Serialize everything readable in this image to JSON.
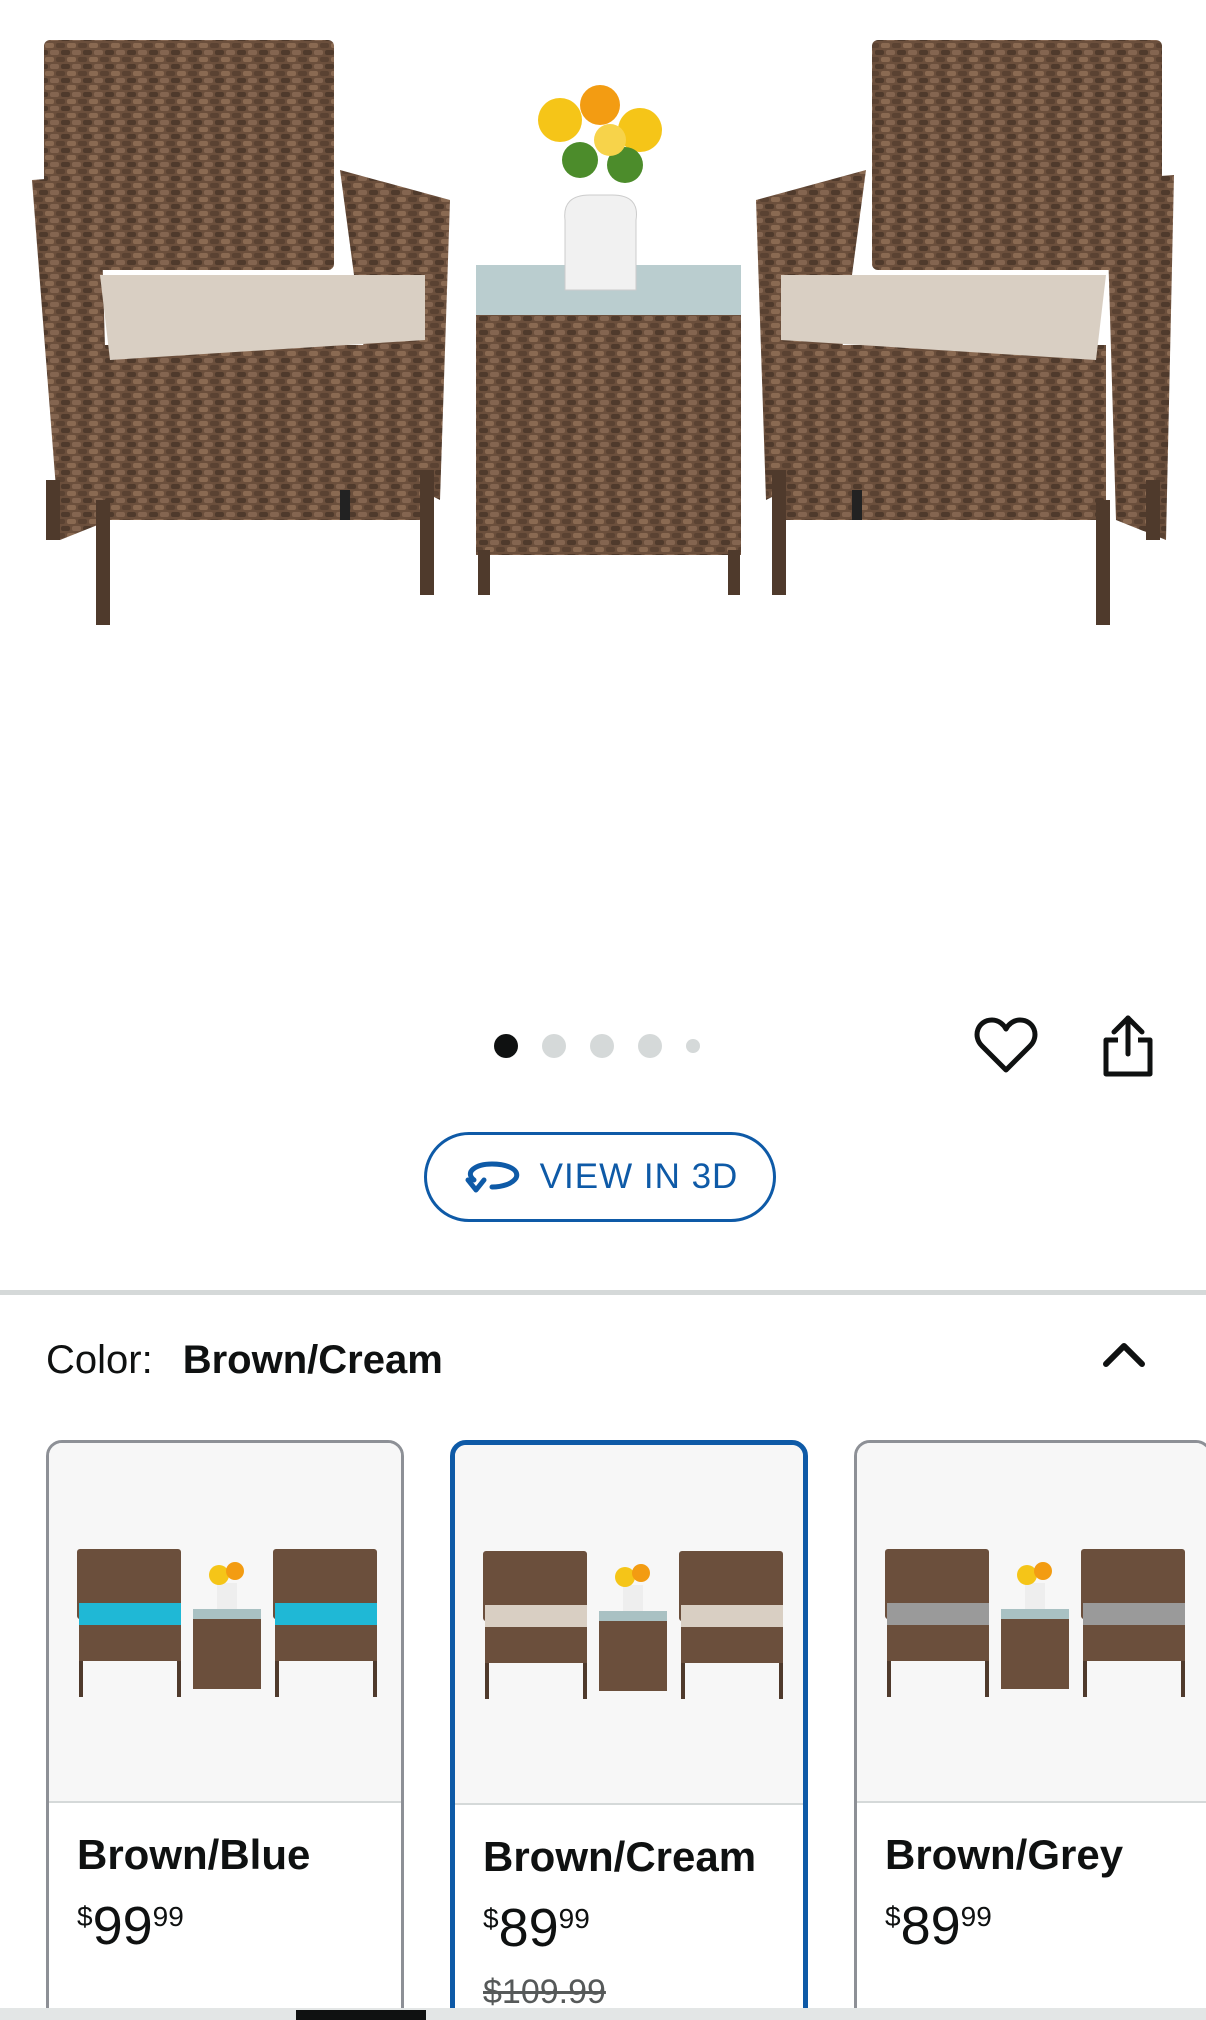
{
  "carousel": {
    "dot_count": 5,
    "active_index": 0
  },
  "actions": {
    "favorite_icon": "heart-icon",
    "share_icon": "share-icon"
  },
  "view3d": {
    "label": "VIEW IN 3D",
    "icon": "rotate-3d-icon"
  },
  "color_selector": {
    "label": "Color:",
    "value": "Brown/Cream",
    "toggle_icon": "chevron-up-icon"
  },
  "swatches": [
    {
      "name": "Brown/Blue",
      "price_symbol": "$",
      "price_whole": "99",
      "price_fraction": "99",
      "list_price": "",
      "cushion_color": "#1fb8d6",
      "selected": false
    },
    {
      "name": "Brown/Cream",
      "price_symbol": "$",
      "price_whole": "89",
      "price_fraction": "99",
      "list_price": "$109.99",
      "cushion_color": "#d9cfc3",
      "selected": true
    },
    {
      "name": "Brown/Grey",
      "price_symbol": "$",
      "price_whole": "89",
      "price_fraction": "99",
      "list_price": "",
      "cushion_color": "#9a9a9a",
      "selected": false
    }
  ],
  "colors": {
    "accent": "#0e5aa7",
    "wicker": "#6b4f3c",
    "hero_cushion": "#d9cfc3"
  }
}
